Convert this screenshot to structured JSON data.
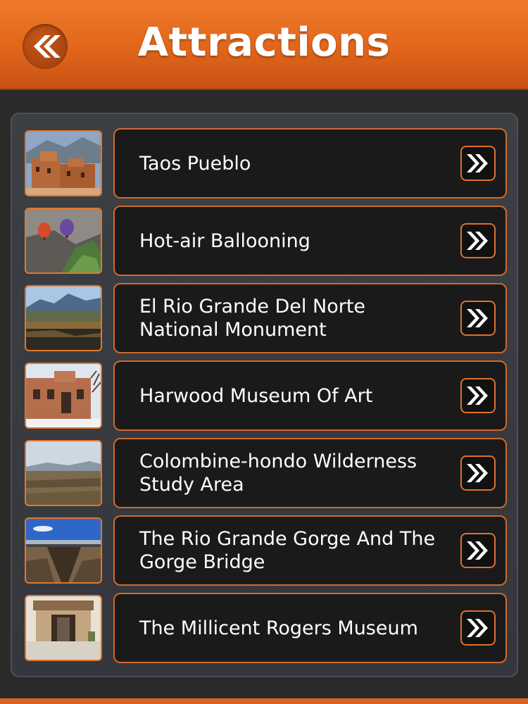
{
  "header": {
    "title": "Attractions",
    "back_icon": "double-chevron-left-icon",
    "color": "#e1661b"
  },
  "attractions": [
    {
      "label": "Taos Pueblo",
      "image": "taos-pueblo-photo"
    },
    {
      "label": "Hot-air Ballooning",
      "image": "hot-air-balloons-photo"
    },
    {
      "label": "El Rio Grande Del Norte National Monument",
      "image": "canyon-landscape-photo"
    },
    {
      "label": "Harwood Museum Of Art",
      "image": "adobe-museum-photo"
    },
    {
      "label": "Colombine-hondo Wilderness Study Area",
      "image": "wilderness-landscape-photo"
    },
    {
      "label": "The Rio Grande Gorge And The Gorge Bridge",
      "image": "gorge-bridge-photo"
    },
    {
      "label": "The Millicent Rogers Museum",
      "image": "museum-entrance-photo"
    }
  ],
  "row_icon": "double-chevron-right-icon",
  "accent_color": "#e3762c"
}
